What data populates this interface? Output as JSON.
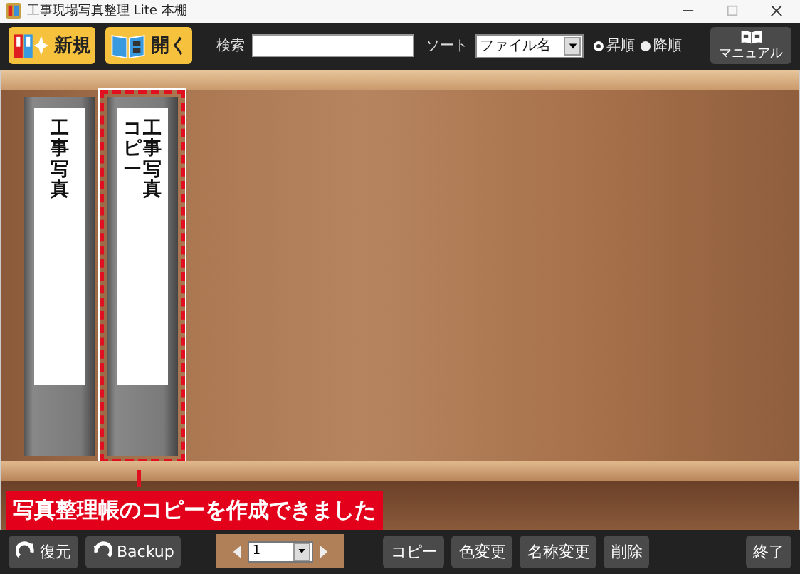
{
  "window": {
    "title": "工事現場写真整理 Lite 本棚"
  },
  "toolbar": {
    "buttons": [
      {
        "kind": "new",
        "label": "新規"
      },
      {
        "kind": "open",
        "label": "開く"
      }
    ],
    "search": {
      "label": "検索"
    },
    "sort": {
      "label": "ソート",
      "value": "ファイル名"
    },
    "order": [
      {
        "label": "昇順",
        "selected": true
      },
      {
        "label": "降順",
        "selected": false
      }
    ],
    "manual": {
      "label": "マニュアル"
    }
  },
  "binders": [
    {
      "title": "工事写真",
      "selected": false
    },
    {
      "title": "工事写真",
      "subtitle": "コピー",
      "selected": true
    }
  ],
  "message": "写真整理帳のコピーを作成できました",
  "bottom": {
    "left": [
      {
        "kind": "restore",
        "label": "復元"
      },
      {
        "kind": "backup",
        "label": "Backup"
      }
    ],
    "page": "1",
    "right": [
      "コピー",
      "色変更",
      "名称変更",
      "削除"
    ],
    "exit": "終了"
  }
}
